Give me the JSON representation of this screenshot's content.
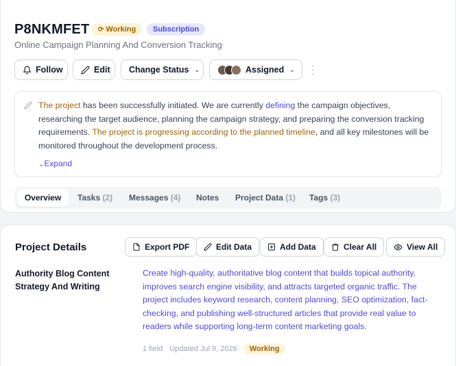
{
  "header": {
    "title": "P8NKMFET",
    "status_badge": "Working",
    "type_badge": "Subscription",
    "subtitle": "Online Campaign Planning And Conversion Tracking"
  },
  "actions": {
    "follow": "Follow",
    "edit": "Edit",
    "change_status": "Change Status",
    "assigned": "Assigned"
  },
  "description": {
    "p1a": "The project",
    "p1b": " has been successfully initiated. We are currently ",
    "p1c": "defining",
    "p1d": " the campaign objectives, researching the target audience, planning the campaign strategy, and preparing the conversion tracking requirements. ",
    "p2a": "The project is progressing according to the planned timeline",
    "p2b": ", and all key milestones will be monitored throughout the development process.",
    "expand": "Expand"
  },
  "tabs": [
    {
      "label": "Overview",
      "count": ""
    },
    {
      "label": "Tasks",
      "count": "(2)"
    },
    {
      "label": "Messages",
      "count": "(4)"
    },
    {
      "label": "Notes",
      "count": ""
    },
    {
      "label": "Project Data",
      "count": "(1)"
    },
    {
      "label": "Tags",
      "count": "(3)"
    }
  ],
  "details": {
    "title": "Project Details",
    "export_pdf": "Export PDF",
    "edit_data": "Edit Data",
    "add_data": "Add Data",
    "clear_all": "Clear All",
    "view_all": "View All",
    "item": {
      "title": "Authority Blog Content Strategy And Writing",
      "description": "Create high-quality, authoritative blog content that builds topical authority, improves search engine visibility, and attracts targeted organic traffic. The project includes keyword research, content planning, SEO optimization, fact-checking, and publishing well-structured articles that provide real value to readers while supporting long-term content marketing goals.",
      "fields": "1 field",
      "updated": "Updated Jul 9, 2026",
      "status": "Working"
    }
  },
  "colors": {
    "accent": "#4f46e5",
    "working_bg": "#fdf3d6",
    "working_fg": "#a16207"
  }
}
